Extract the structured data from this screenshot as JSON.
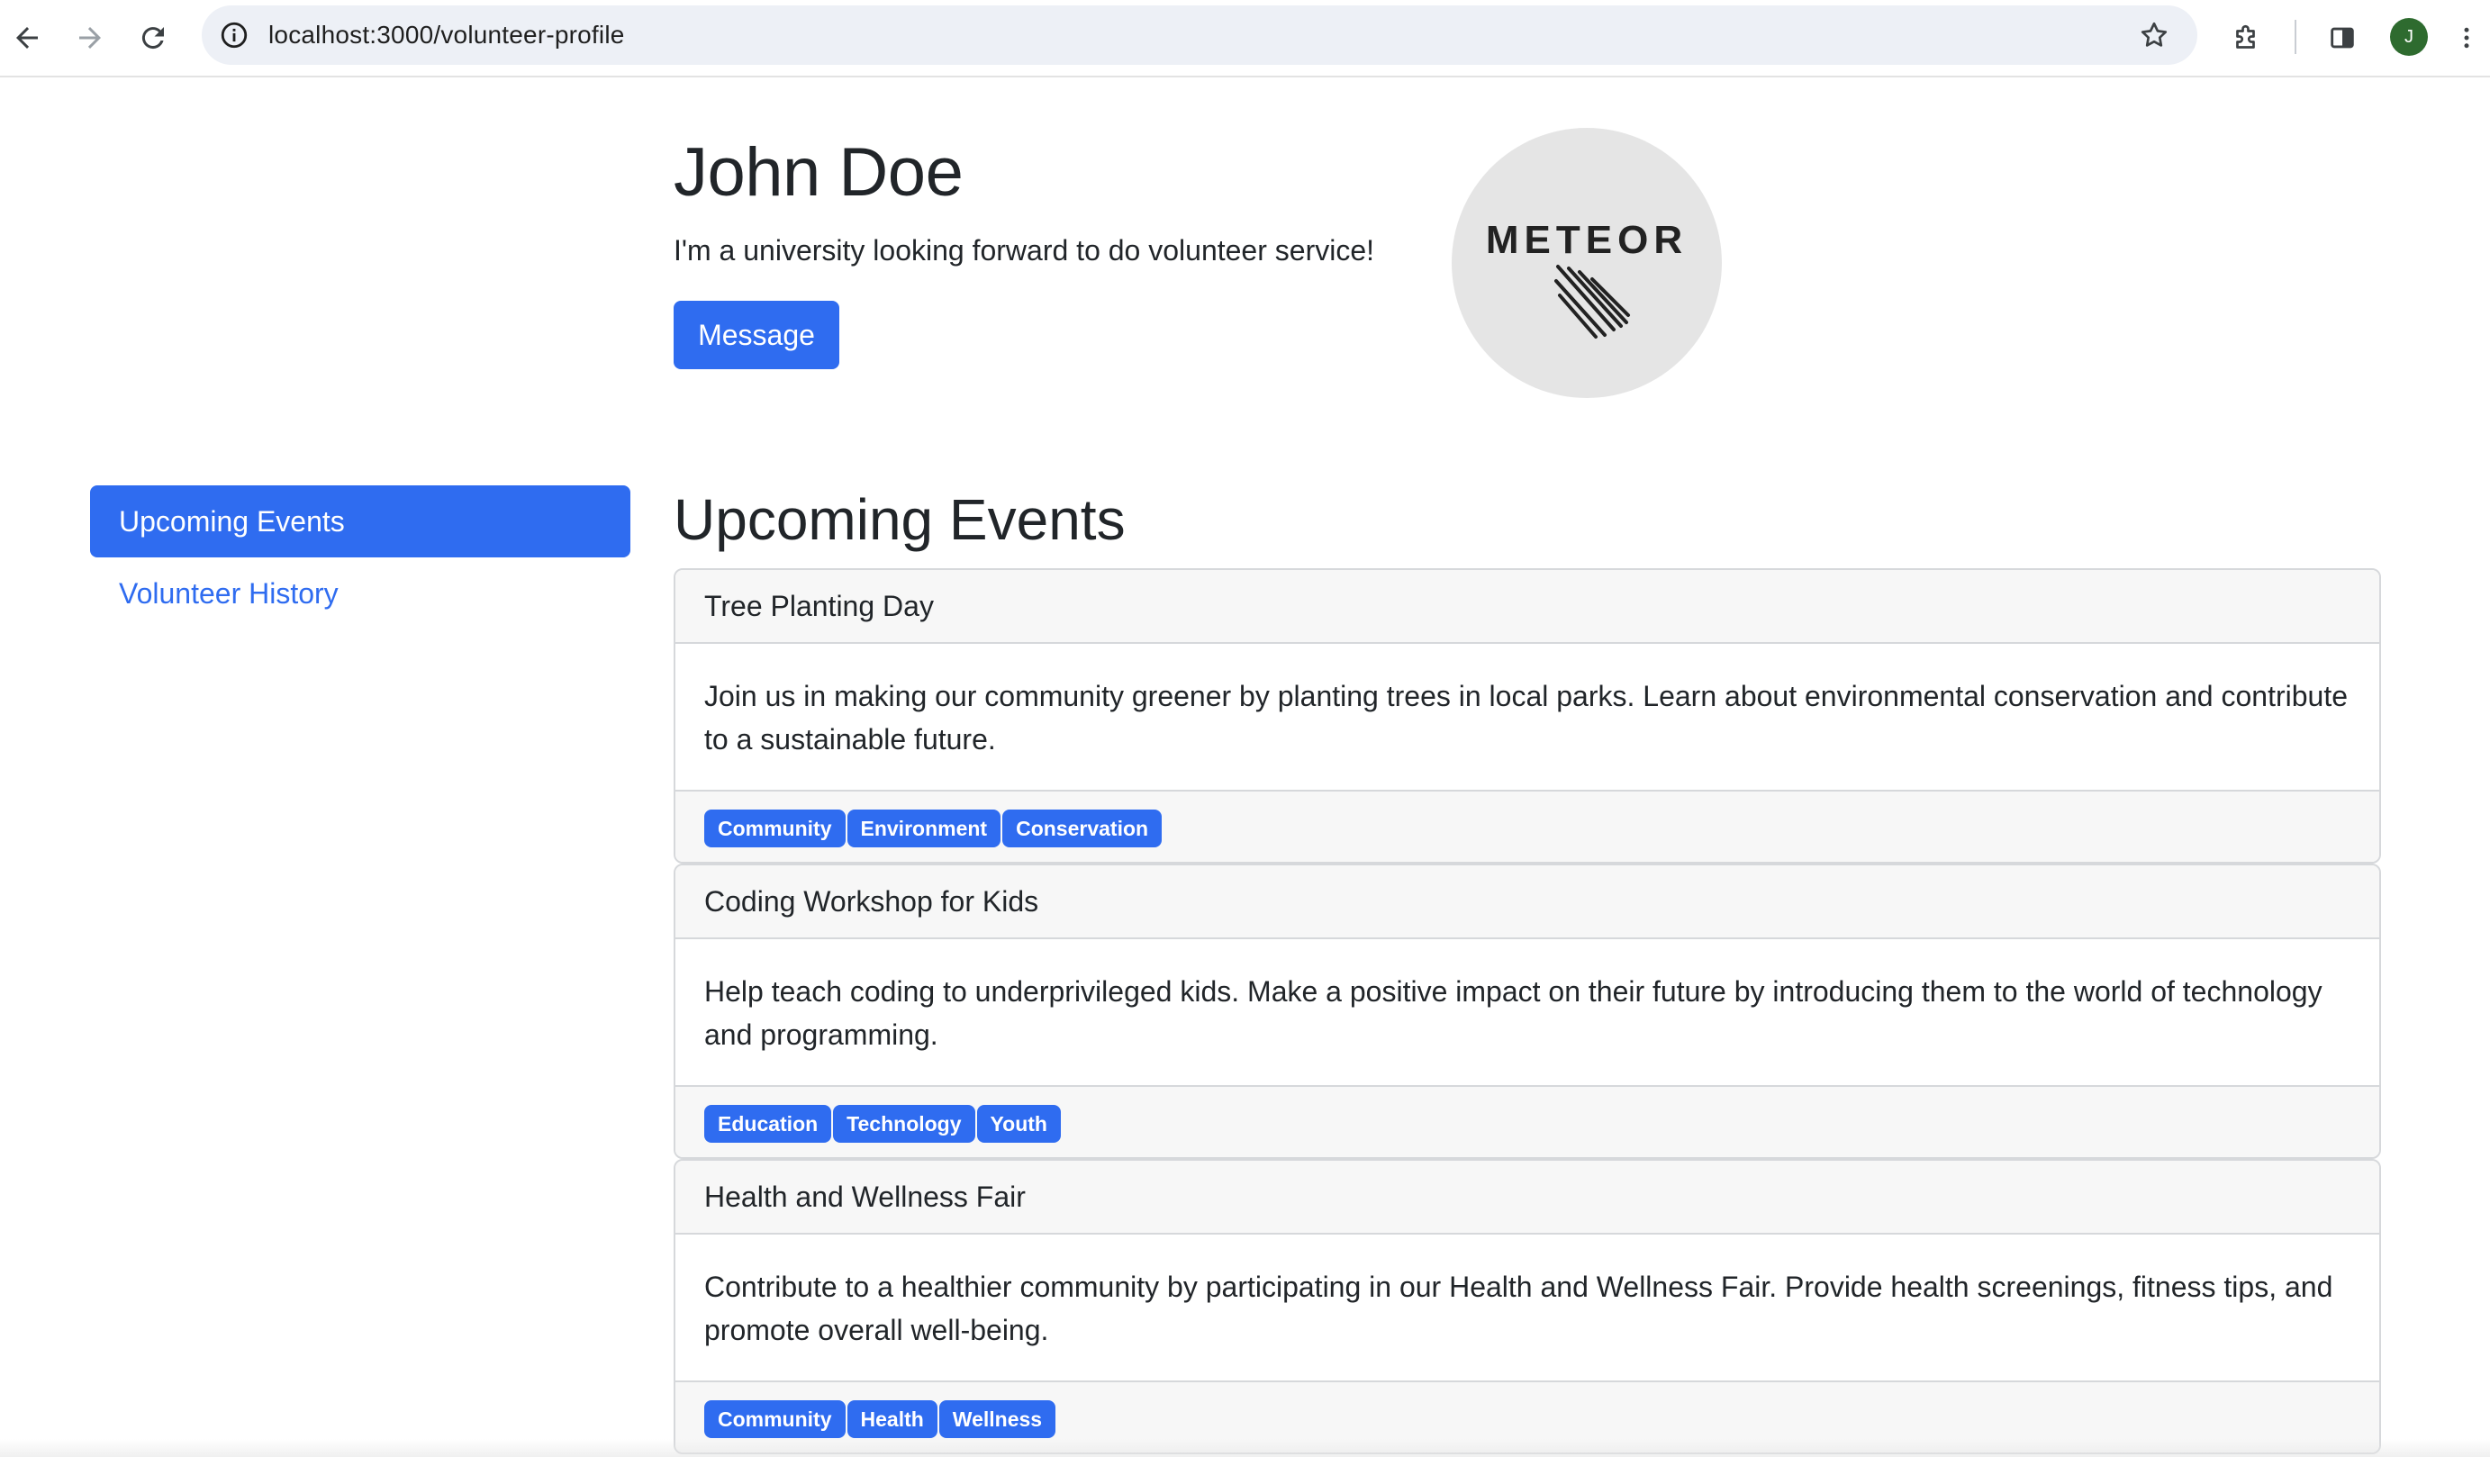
{
  "browser": {
    "url": "localhost:3000/volunteer-profile",
    "profile_initial": "J"
  },
  "profile": {
    "name": "John Doe",
    "bio": "I'm a university looking forward to do volunteer service!",
    "message_label": "Message",
    "logo_text": "METEOR"
  },
  "sidebar": {
    "items": [
      {
        "label": "Upcoming Events",
        "active": true
      },
      {
        "label": "Volunteer History",
        "active": false
      }
    ]
  },
  "main": {
    "title": "Upcoming Events",
    "events": [
      {
        "title": "Tree Planting Day",
        "description": "Join us in making our community greener by planting trees in local parks. Learn about environmental conservation and contribute to a sustainable future.",
        "tags": [
          "Community",
          "Environment",
          "Conservation"
        ]
      },
      {
        "title": "Coding Workshop for Kids",
        "description": "Help teach coding to underprivileged kids. Make a positive impact on their future by introducing them to the world of technology and programming.",
        "tags": [
          "Education",
          "Technology",
          "Youth"
        ]
      },
      {
        "title": "Health and Wellness Fair",
        "description": "Contribute to a healthier community by participating in our Health and Wellness Fair. Provide health screenings, fitness tips, and promote overall well-being.",
        "tags": [
          "Community",
          "Health",
          "Wellness"
        ]
      }
    ]
  },
  "colors": {
    "primary": "#2f6cf0",
    "card_header_bg": "#f7f7f7",
    "avatar_bg": "#2e6b2f"
  }
}
